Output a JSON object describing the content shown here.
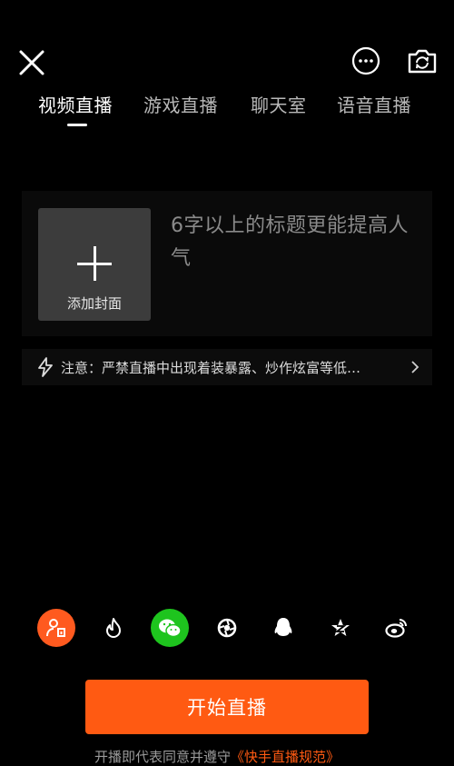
{
  "header": {
    "close_icon": "close-icon",
    "more_icon": "more-icon",
    "camera_icon": "flip-camera-icon"
  },
  "tabs": [
    {
      "label": "视频直播",
      "active": true
    },
    {
      "label": "游戏直播",
      "active": false
    },
    {
      "label": "聊天室",
      "active": false
    },
    {
      "label": "语音直播",
      "active": false
    }
  ],
  "cover": {
    "label": "添加封面",
    "icon": "plus-icon"
  },
  "title_input": {
    "placeholder": "6字以上的标题更能提高人气"
  },
  "notice": {
    "text": "注意：严禁直播中出现着装暴露、炒作炫富等低…"
  },
  "share_targets": [
    {
      "icon": "contacts-icon",
      "selected": true,
      "color": "#ff5a1f"
    },
    {
      "icon": "fire-icon",
      "selected": false
    },
    {
      "icon": "wechat-icon",
      "selected": true,
      "color": "#1ec41e"
    },
    {
      "icon": "moments-icon",
      "selected": false
    },
    {
      "icon": "qq-icon",
      "selected": false
    },
    {
      "icon": "qzone-icon",
      "selected": false
    },
    {
      "icon": "weibo-icon",
      "selected": false
    }
  ],
  "start_button": {
    "label": "开始直播",
    "color": "#ff5a12"
  },
  "agreement": {
    "text": "开播即代表同意并遵守",
    "link": "《快手直播规范》"
  }
}
